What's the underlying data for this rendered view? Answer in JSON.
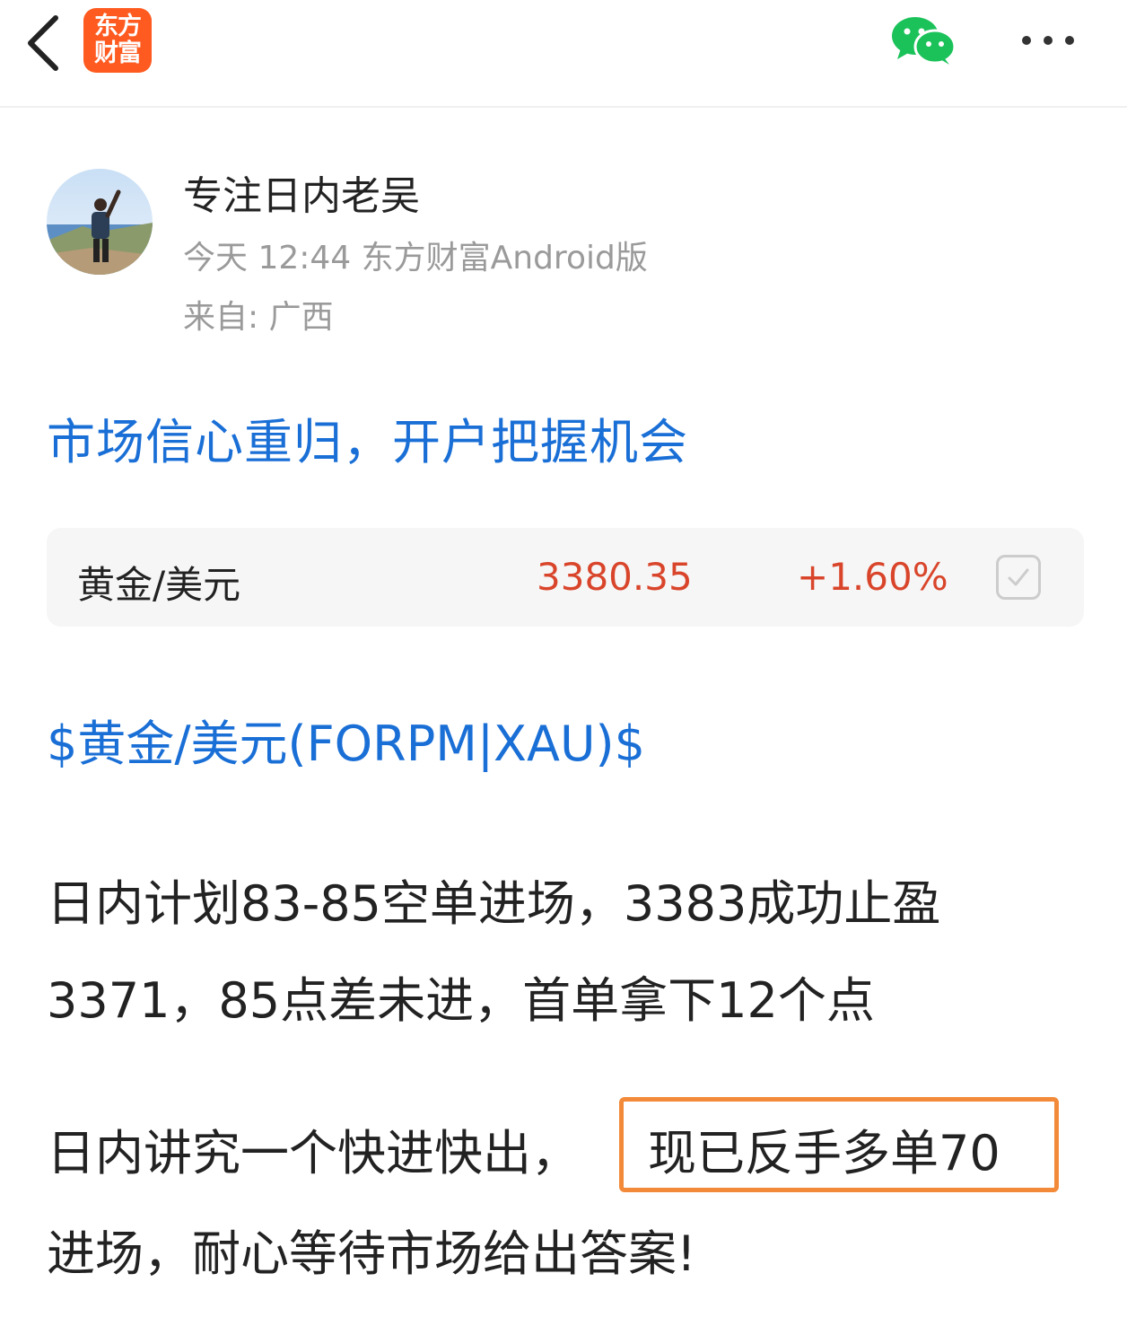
{
  "topbar": {
    "logo_line1": "东方",
    "logo_line2": "财富",
    "back_icon": "chevron-left-icon",
    "share_icon": "wechat-icon",
    "more_icon": "more-horizontal-icon"
  },
  "author": {
    "name": "专注日内老吴",
    "meta": "今天 12:44 东方财富Android版",
    "location": "来自: 广西"
  },
  "promo_link": "市场信心重归，开户把握机会",
  "quote": {
    "name": "黄金/美元",
    "price": "3380.35",
    "change": "+1.60%",
    "accent_color": "#d9452b"
  },
  "stock_tag": "$黄金/美元(FORPM|XAU)$",
  "body": {
    "line1": "日内计划83-85空单进场，3383成功止盈",
    "line2": "3371，85点差未进，首单拿下12个点",
    "line3_prefix": "日内讲究一个快进快出，",
    "line3_highlight": "现已反手多单70",
    "line4": "进场，耐心等待市场给出答案!"
  },
  "colors": {
    "link_blue": "#1a6fd6",
    "highlight_border": "#f28a3a",
    "brand_orange": "#ff5a1f"
  }
}
